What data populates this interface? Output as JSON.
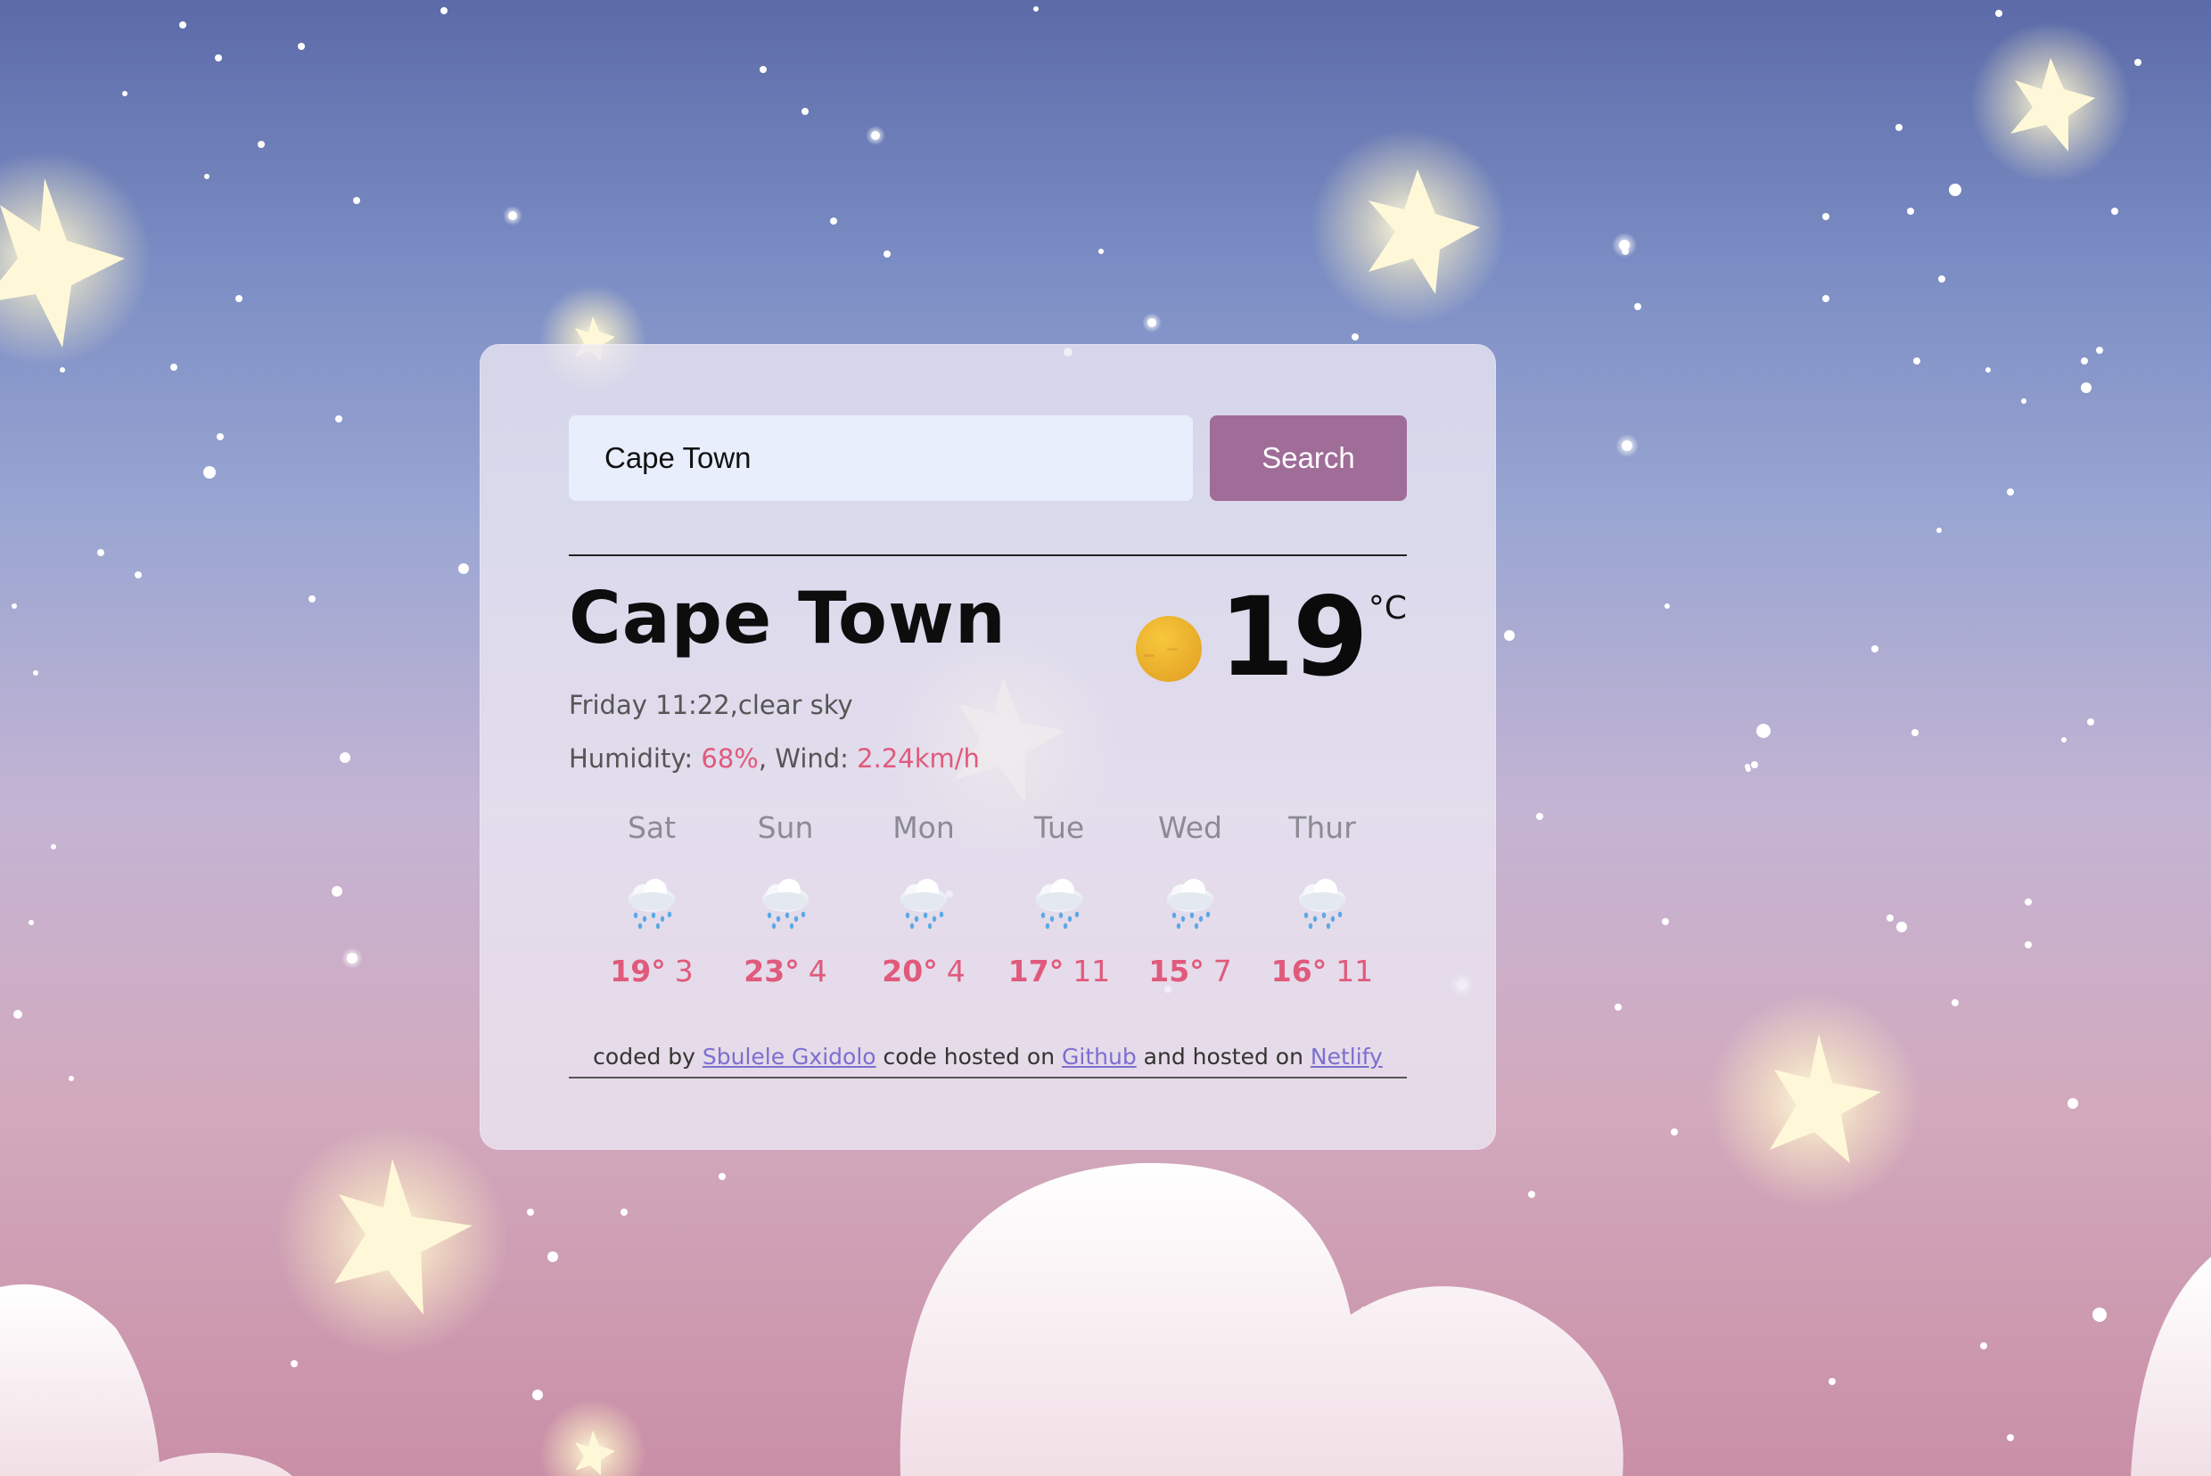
{
  "search": {
    "value": "Cape Town",
    "button_label": "Search"
  },
  "current": {
    "city": "Cape Town",
    "datetime_description": "Friday 11:22,clear sky",
    "humidity_label": "Humidity: ",
    "humidity_value": "68%",
    "wind_label": ", Wind: ",
    "wind_value": "2.24km/h",
    "temperature": "19",
    "unit": "°C",
    "icon": "sun-icon"
  },
  "forecast": [
    {
      "day": "Sat",
      "icon": "rain-cloud-icon",
      "max": "19°",
      "min": "3"
    },
    {
      "day": "Sun",
      "icon": "rain-cloud-icon",
      "max": "23°",
      "min": "4"
    },
    {
      "day": "Mon",
      "icon": "rain-cloud-icon",
      "max": "20°",
      "min": "4"
    },
    {
      "day": "Tue",
      "icon": "rain-cloud-icon",
      "max": "17°",
      "min": "11"
    },
    {
      "day": "Wed",
      "icon": "rain-cloud-icon",
      "max": "15°",
      "min": "7"
    },
    {
      "day": "Thur",
      "icon": "rain-cloud-icon",
      "max": "16°",
      "min": "11"
    }
  ],
  "footer": {
    "text1": "coded by ",
    "author_link": "Sbulele Gxidolo",
    "text2": " code hosted on ",
    "code_link": "Github",
    "text3": " and hosted on ",
    "host_link": "Netlify"
  },
  "colors": {
    "accent": "#e05a7c",
    "button": "#a06c98",
    "link": "#7b6fd0",
    "input_bg": "#e8eefb"
  }
}
